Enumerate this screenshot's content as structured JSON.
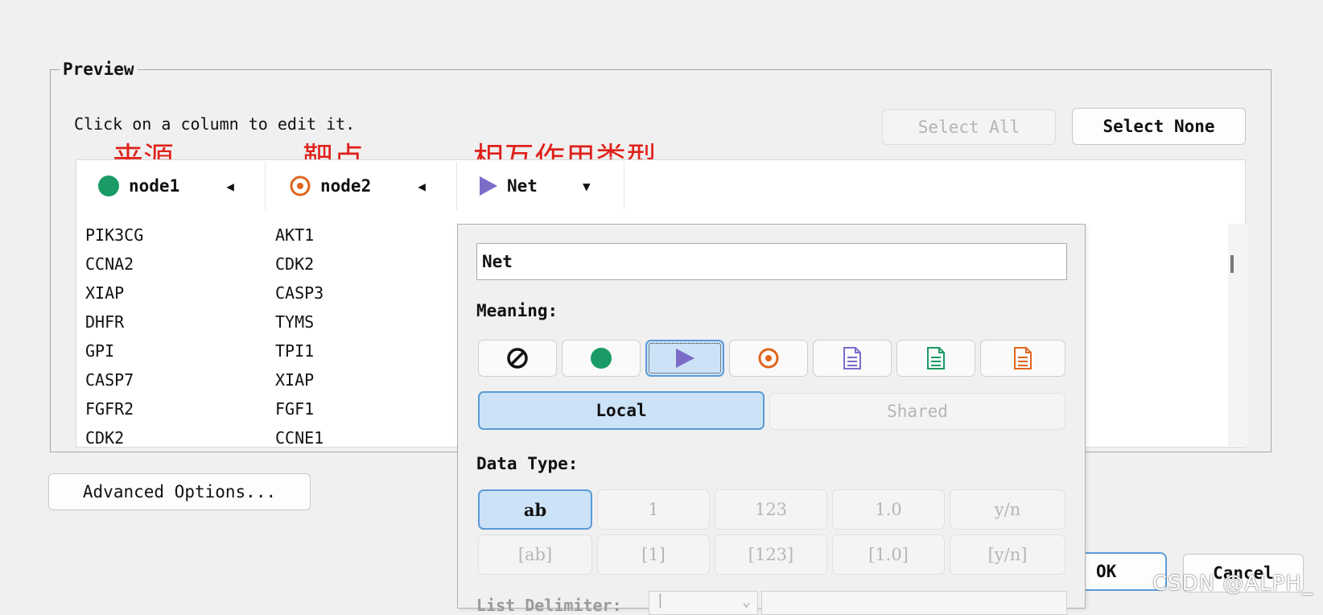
{
  "preview": {
    "group_title": "Preview",
    "hint": "Click on a column to edit it.",
    "select_all_label": "Select All",
    "select_none_label": "Select None"
  },
  "annotations": {
    "source": "来源",
    "target": "靶点",
    "interaction_type": "相互作用类型"
  },
  "columns": [
    {
      "label": "node1",
      "icon": "green-circle-icon",
      "color": "#1a9a64",
      "arrow": "left"
    },
    {
      "label": "node2",
      "icon": "orange-target-icon",
      "color": "#e0661c",
      "arrow": "left"
    },
    {
      "label": "Net",
      "icon": "purple-triangle-icon",
      "color": "#7b6cc8",
      "arrow": "down"
    }
  ],
  "rows": [
    [
      "PIK3CG",
      "AKT1"
    ],
    [
      "CCNA2",
      "CDK2"
    ],
    [
      "XIAP",
      "CASP3"
    ],
    [
      "DHFR",
      "TYMS"
    ],
    [
      "GPI",
      "TPI1"
    ],
    [
      "CASP7",
      "XIAP"
    ],
    [
      "FGFR2",
      "FGF1"
    ],
    [
      "CDK2",
      "CCNE1"
    ]
  ],
  "popup": {
    "name_value": "Net",
    "meaning_label": "Meaning:",
    "meaning_icons": [
      "none-icon",
      "source-node-icon",
      "interaction-icon",
      "target-node-icon",
      "attribute-doc-icon",
      "edge-attribute-doc-icon",
      "target-attribute-doc-icon"
    ],
    "selected_meaning": "interaction-icon",
    "scope": {
      "local": "Local",
      "shared": "Shared",
      "selected": "Local"
    },
    "data_type_label": "Data Type:",
    "data_types_row1": [
      "ab",
      "1",
      "123",
      "1.0",
      "y/n"
    ],
    "data_types_row2": [
      "[ab]",
      "[1]",
      "[123]",
      "[1.0]",
      "[y/n]"
    ],
    "selected_data_type": "ab",
    "list_delimiter_label": "List Delimiter:",
    "list_delimiter_value": "|"
  },
  "footer": {
    "advanced_options_label": "Advanced Options...",
    "ok_label": "OK",
    "cancel_label": "Cancel"
  },
  "watermark": "CSDN @ALPH_",
  "colors": {
    "accent_blue": "#5b9bd5",
    "selected_fill": "#cce2f7",
    "annotation_red": "#e0201a",
    "green": "#1a9a64",
    "orange": "#e0661c",
    "purple": "#7b6cc8",
    "doc_purple": "#7b6cc8",
    "doc_green": "#1a9a64",
    "doc_orange": "#e0661c"
  }
}
